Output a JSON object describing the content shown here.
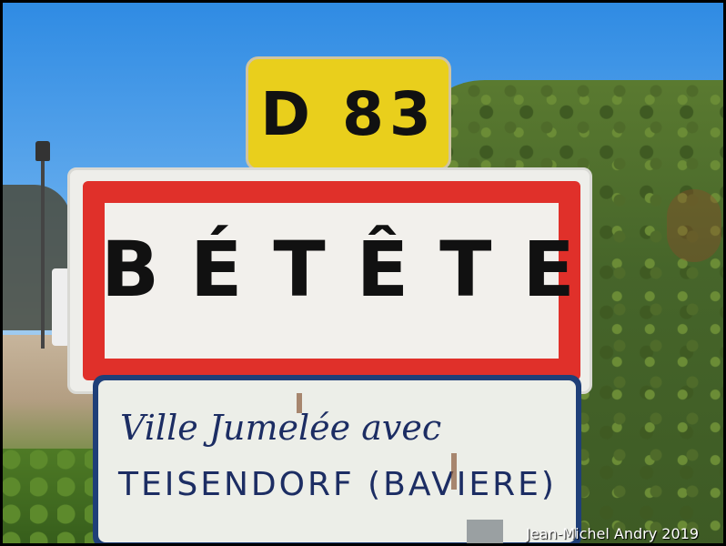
{
  "route_sign": {
    "label": "D 83"
  },
  "town_sign": {
    "name": "BÉTÊTE"
  },
  "twinning_sign": {
    "line1": "Ville Jumelée avec",
    "line2": "TEISENDORF (BAVIERE)"
  },
  "credit": {
    "text": "Jean-Michel Andry 2019"
  },
  "colors": {
    "route_sign_yellow": "#e9cf1c",
    "town_sign_red": "#e0302a",
    "twinning_blue": "#1f3f78"
  }
}
